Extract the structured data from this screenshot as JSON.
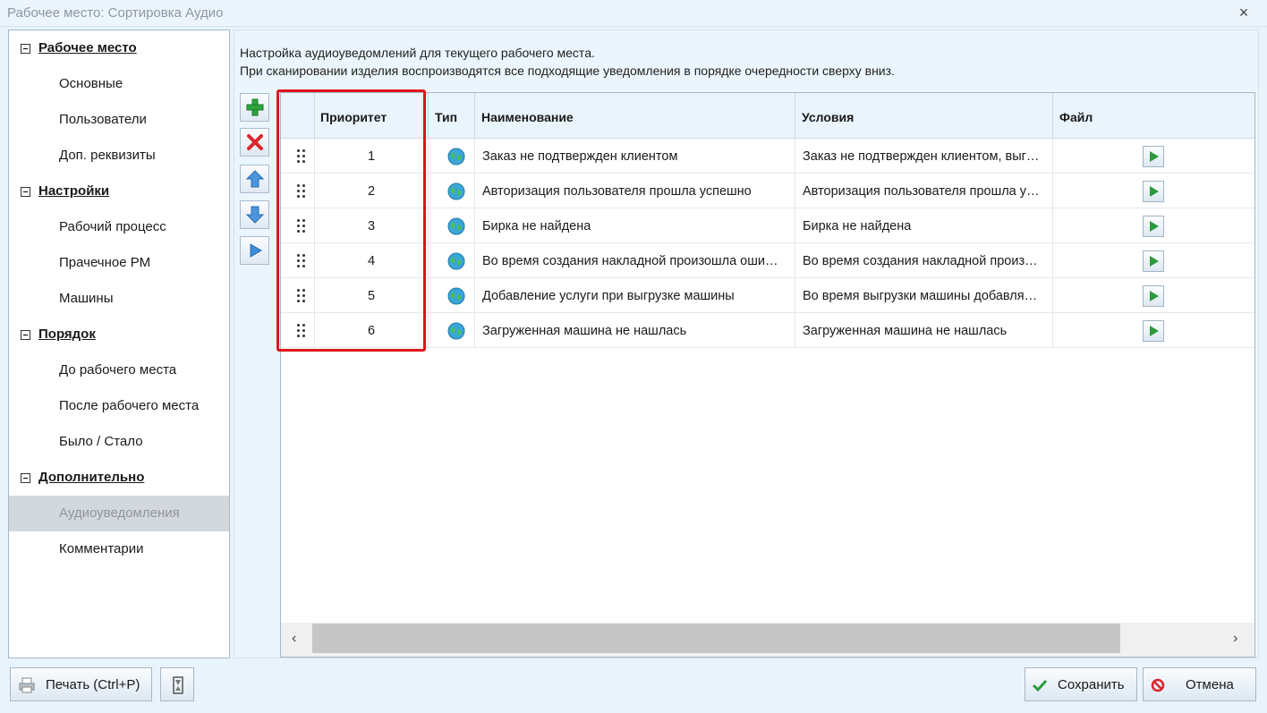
{
  "window": {
    "title": "Рабочее место: Сортировка Аудио",
    "close_icon": "×"
  },
  "sidebar": {
    "items": [
      {
        "label": "Рабочее место",
        "kind": "group"
      },
      {
        "label": "Основные",
        "kind": "item"
      },
      {
        "label": "Пользователи",
        "kind": "item"
      },
      {
        "label": "Доп. реквизиты",
        "kind": "item"
      },
      {
        "label": "Настройки",
        "kind": "group"
      },
      {
        "label": "Рабочий процесс",
        "kind": "item"
      },
      {
        "label": "Прачечное РМ",
        "kind": "item"
      },
      {
        "label": "Машины",
        "kind": "item"
      },
      {
        "label": "Порядок",
        "kind": "group"
      },
      {
        "label": "До рабочего места",
        "kind": "item"
      },
      {
        "label": "После рабочего места",
        "kind": "item"
      },
      {
        "label": "Было / Стало",
        "kind": "item"
      },
      {
        "label": "Дополнительно",
        "kind": "group"
      },
      {
        "label": "Аудиоуведомления",
        "kind": "item",
        "selected": true
      },
      {
        "label": "Комментарии",
        "kind": "item"
      }
    ]
  },
  "main": {
    "description_line1": "Настройка аудиоуведомлений для текущего рабочего места.",
    "description_line2": "При сканировании изделия воспроизводятся все подходящие уведомления в порядке очередности сверху вниз.",
    "toolbar": {
      "add_icon": "plus-icon",
      "delete_icon": "x-icon",
      "up_icon": "arrow-up-icon",
      "down_icon": "arrow-down-icon",
      "play_icon": "play-icon"
    },
    "grid": {
      "columns": {
        "priority": "Приоритет",
        "type": "Тип",
        "name": "Наименование",
        "conditions": "Условия",
        "file": "Файл"
      },
      "rows": [
        {
          "priority": "1",
          "name": "Заказ не подтвержден клиентом",
          "conditions": "Заказ не подтвержден клиентом, выг…"
        },
        {
          "priority": "2",
          "name": "Авторизация пользователя прошла успешно",
          "conditions": "Авторизация пользователя прошла у…"
        },
        {
          "priority": "3",
          "name": "Бирка не найдена",
          "conditions": "Бирка не найдена"
        },
        {
          "priority": "4",
          "name": "Во время создания накладной произошла оши…",
          "conditions": "Во время создания накладной произ…"
        },
        {
          "priority": "5",
          "name": "Добавление услуги при выгрузке машины",
          "conditions": "Во время выгрузки машины добавля…"
        },
        {
          "priority": "6",
          "name": "Загруженная машина не нашлась",
          "conditions": "Загруженная машина не нашлась"
        }
      ],
      "scroll_left": "‹",
      "scroll_right": "›"
    }
  },
  "footer": {
    "print_label": "Печать (Ctrl+P)",
    "save_label": "Сохранить",
    "cancel_label": "Отмена"
  },
  "colors": {
    "accent_green": "#2c9a3b",
    "delete_red": "#d9252f",
    "highlight_red": "#e0121c",
    "arrow_blue": "#3d8bd5"
  }
}
